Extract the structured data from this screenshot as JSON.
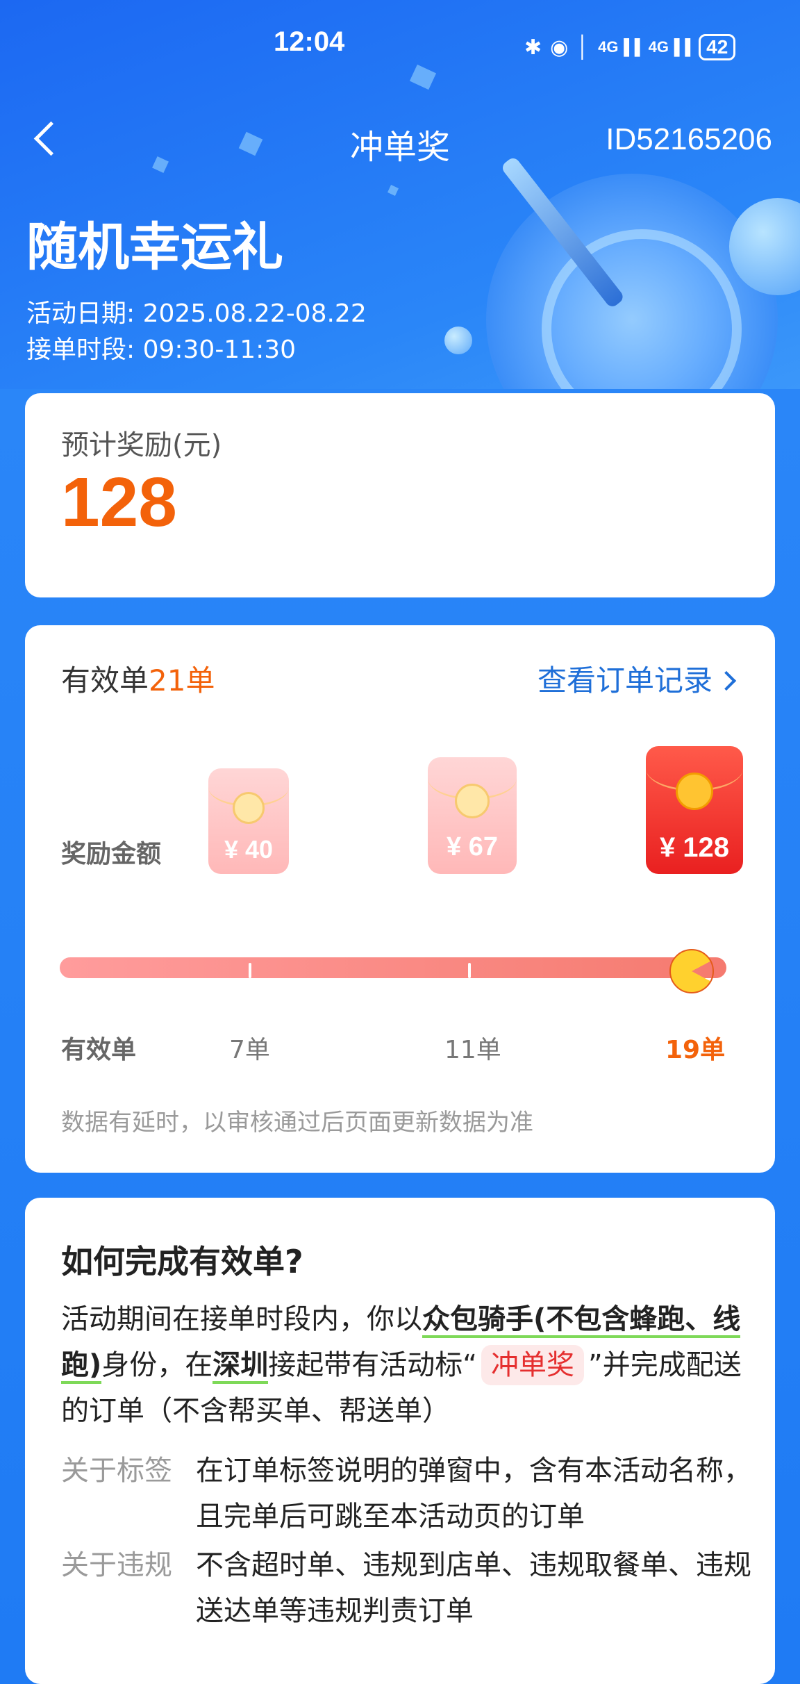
{
  "status_bar": {
    "time": "12:04",
    "icons": [
      "bluetooth-icon",
      "location-icon",
      "mic-icon",
      "signal-4g-icon",
      "signal-4g-icon"
    ],
    "signal_label": "4G",
    "battery": "42"
  },
  "nav": {
    "title": "冲单奖",
    "id": "ID52165206"
  },
  "hero": {
    "title": "随机幸运礼",
    "date_line": "活动日期: 2025.08.22-08.22",
    "period_line": "接单时段: 09:30-11:30"
  },
  "reward_card": {
    "label": "预计奖励(元)",
    "value": "128"
  },
  "progress_card": {
    "valid_prefix": "有效单",
    "valid_count": "21单",
    "orders_link": "查看订单记录",
    "reward_label": "奖励金额",
    "tiers": [
      {
        "amount": "¥ 40",
        "orders": "7单",
        "achieved": true
      },
      {
        "amount": "¥ 67",
        "orders": "11单",
        "achieved": true
      },
      {
        "amount": "¥ 128",
        "orders": "19单",
        "achieved": true,
        "current": true
      }
    ],
    "progress": 1.0,
    "orders_axis_label": "有效单",
    "note": "数据有延时，以审核通过后页面更新数据为准"
  },
  "how_card": {
    "title": "如何完成有效单?",
    "body": {
      "p1": "活动期间在接单时段内，你以",
      "b1": "众包骑手(不包含蜂跑、线跑)",
      "p2": "身份，在",
      "b2": "深圳",
      "p3": "接起带有活动标“",
      "tag": "冲单奖",
      "p4": "”并完成配送的订单（不含帮买单、帮送单）"
    },
    "rules": [
      {
        "key": "关于标签",
        "value": "在订单标签说明的弹窗中，含有本活动名称，且完单后可跳至本活动页的订单"
      },
      {
        "key": "关于违规",
        "value": "不含超时单、违规到店单、违规取餐单、违规送达单等违规判责订单"
      }
    ]
  },
  "colors": {
    "primary_blue": "#1f7bf4",
    "accent_orange": "#f3620a",
    "link_blue": "#1f6fd8",
    "tag_red": "#e52f2f"
  }
}
